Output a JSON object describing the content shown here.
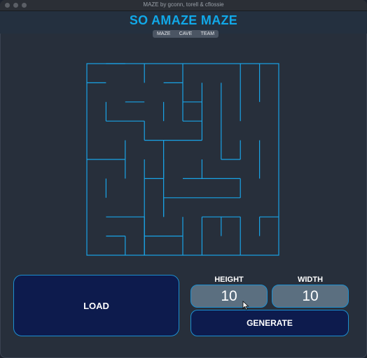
{
  "window": {
    "title": "MAZE by gconn, torell & cflossie"
  },
  "header": {
    "title": "SO AMAZE MAZE"
  },
  "tabs": [
    {
      "label": "MAZE"
    },
    {
      "label": "CAVE"
    },
    {
      "label": "TEAM"
    }
  ],
  "maze": {
    "rows": 10,
    "cols": 10,
    "wall_color": "#19a3e6",
    "horizontal_walls": [
      [
        0,
        1,
        2
      ],
      [
        1,
        0,
        1
      ],
      [
        1,
        4,
        5
      ],
      [
        2,
        2,
        3
      ],
      [
        2,
        5,
        6
      ],
      [
        3,
        1,
        3
      ],
      [
        3,
        5,
        6
      ],
      [
        4,
        3,
        6
      ],
      [
        5,
        0,
        2
      ],
      [
        5,
        7,
        8
      ],
      [
        6,
        3,
        4
      ],
      [
        6,
        5,
        8
      ],
      [
        7,
        4,
        8
      ],
      [
        8,
        1,
        3
      ],
      [
        8,
        6,
        8
      ],
      [
        8,
        9,
        10
      ],
      [
        9,
        1,
        2
      ],
      [
        9,
        3,
        5
      ]
    ],
    "vertical_walls": [
      [
        3,
        0,
        1
      ],
      [
        5,
        0,
        3
      ],
      [
        8,
        0,
        3
      ],
      [
        9,
        0,
        2
      ],
      [
        6,
        1,
        4
      ],
      [
        7,
        1,
        4
      ],
      [
        1,
        2,
        3
      ],
      [
        4,
        2,
        3
      ],
      [
        3,
        3,
        4
      ],
      [
        2,
        4,
        6
      ],
      [
        4,
        4,
        6
      ],
      [
        8,
        4,
        5
      ],
      [
        7,
        4,
        5
      ],
      [
        3,
        5,
        10
      ],
      [
        4,
        5,
        8
      ],
      [
        6,
        5,
        6
      ],
      [
        9,
        4,
        6
      ],
      [
        8,
        6,
        7
      ],
      [
        1,
        6,
        7
      ],
      [
        4,
        7,
        8
      ],
      [
        3,
        8,
        10
      ],
      [
        5,
        8,
        10
      ],
      [
        6,
        8,
        10
      ],
      [
        7,
        8,
        9
      ],
      [
        8,
        8,
        10
      ],
      [
        9,
        8,
        9
      ],
      [
        2,
        9,
        10
      ]
    ]
  },
  "controls": {
    "load_label": "LOAD",
    "height_label": "HEIGHT",
    "width_label": "WIDTH",
    "height_value": "10",
    "width_value": "10",
    "generate_label": "GENERATE"
  }
}
